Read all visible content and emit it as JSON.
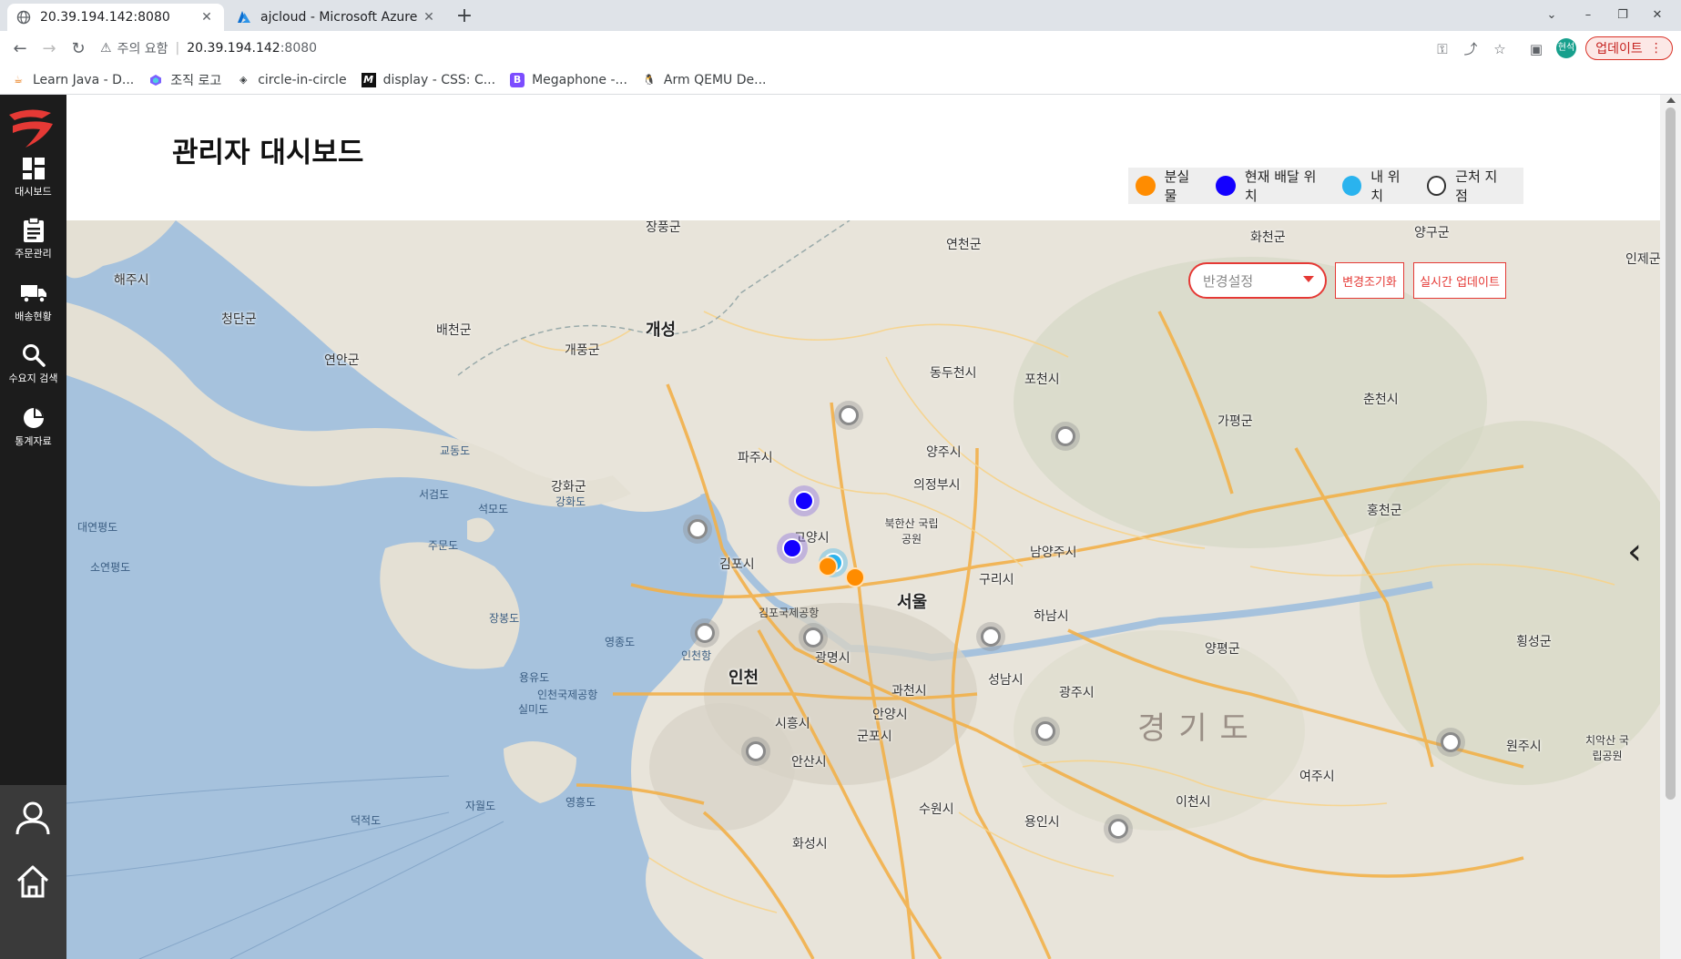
{
  "browser": {
    "tabs": [
      {
        "title": "20.39.194.142:8080",
        "icon": "globe-icon"
      },
      {
        "title": "ajcloud - Microsoft Azure",
        "icon": "azure-icon"
      }
    ],
    "url": {
      "warning": "주의 요함",
      "host": "20.39.194.142",
      "port": ":8080"
    },
    "profile_initials": "현석",
    "update_label": "업데이트",
    "bookmarks": [
      {
        "label": "Learn Java - D...",
        "icon": "java-icon"
      },
      {
        "label": "조직 로고",
        "icon": "org-logo-icon"
      },
      {
        "label": "circle-in-circle",
        "icon": "codepen-icon"
      },
      {
        "label": "display - CSS: C...",
        "icon": "mdn-icon"
      },
      {
        "label": "Megaphone -...",
        "icon": "megaphone-icon"
      },
      {
        "label": "Arm QEMU De...",
        "icon": "linux-icon"
      }
    ]
  },
  "sidebar": {
    "items": [
      {
        "label": "대시보드",
        "icon": "dashboard-icon"
      },
      {
        "label": "주문관리",
        "icon": "clipboard-icon"
      },
      {
        "label": "배송현황",
        "icon": "truck-icon"
      },
      {
        "label": "수요지 검색",
        "icon": "search-icon"
      },
      {
        "label": "통계자료",
        "icon": "pie-chart-icon"
      }
    ],
    "bottom": [
      {
        "icon": "user-icon"
      },
      {
        "icon": "home-icon"
      }
    ]
  },
  "main": {
    "title": "관리자 대시보드",
    "legend": [
      {
        "label": "분실물",
        "color": "#ff8c00"
      },
      {
        "label": "현재 배달 위치",
        "color": "#1300ff"
      },
      {
        "label": "내 위치",
        "color": "#2ab3ee"
      },
      {
        "label": "근처 지점",
        "color": "#ffffff"
      }
    ],
    "map": {
      "radius_placeholder": "반경설정",
      "reset_label": "변경조기화",
      "realtime_label": "실시간 업데이트",
      "province": "경기도",
      "places": [
        "장풍군",
        "연천군",
        "화천군",
        "양구군",
        "인제군",
        "해주시",
        "청단군",
        "개성",
        "배천군",
        "개풍군",
        "연안군",
        "동두천시",
        "포천시",
        "춘천시",
        "가평군",
        "파주시",
        "양주시",
        "의정부시",
        "교동도",
        "강화군",
        "강화도",
        "서검도",
        "석모도",
        "고양시",
        "북한산 국립공원",
        "대연평도",
        "소연평도",
        "주문도",
        "김포시",
        "서울",
        "구리시",
        "남양주시",
        "홍천군",
        "장봉도",
        "영종도",
        "인천항",
        "인천",
        "광명시",
        "하남시",
        "양평군",
        "횡성군",
        "용유도",
        "인천국제공항",
        "실미도",
        "시흥시",
        "안양시",
        "과천시",
        "성남시",
        "광주시",
        "원주시",
        "안산시",
        "군포시",
        "수원시",
        "용인시",
        "이천시",
        "여주시",
        "치악산 국립공원",
        "영흥도",
        "자월도",
        "덕적도",
        "화성시",
        "김포국제공항"
      ]
    }
  }
}
